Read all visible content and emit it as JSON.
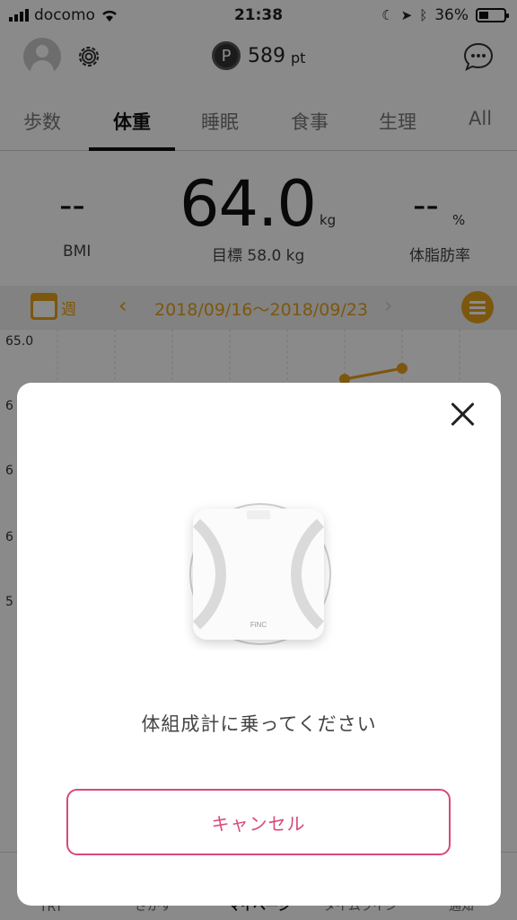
{
  "status_bar": {
    "carrier": "docomo",
    "time": "21:38",
    "battery": "36%"
  },
  "header": {
    "points_icon": "P",
    "points_value": "589",
    "points_unit": "pt"
  },
  "tabs": [
    {
      "label": "歩数"
    },
    {
      "label": "体重"
    },
    {
      "label": "睡眠"
    },
    {
      "label": "食事"
    },
    {
      "label": "生理"
    },
    {
      "label": "All"
    }
  ],
  "stats": {
    "bmi_value": "--",
    "bmi_label": "BMI",
    "weight_value": "64.0",
    "weight_unit": "kg",
    "target_label": "目標 58.0 kg",
    "fat_value": "--",
    "fat_unit": "%",
    "fat_label": "体脂肪率"
  },
  "week_bar": {
    "mode": "週",
    "range": "2018/09/16〜2018/09/23"
  },
  "chart": {
    "tick_top": "65.0",
    "tick_partial": [
      "6",
      "6",
      "6",
      "5"
    ],
    "accent": "#e6a21a"
  },
  "bottom_nav": [
    {
      "label": "TRY"
    },
    {
      "label": "さがす"
    },
    {
      "label": "マイページ"
    },
    {
      "label": "タイムライン"
    },
    {
      "label": "通知"
    }
  ],
  "modal": {
    "prompt": "体組成計に乗ってください",
    "cancel_label": "キャンセル",
    "scale_brand": "FiNC",
    "accent": "#d8487c"
  },
  "icons": {
    "close": "close-icon",
    "gear": "gear-icon",
    "chat": "chat-bubble-icon",
    "avatar": "user-avatar-icon",
    "calendar": "calendar-icon",
    "menu": "menu-icon"
  }
}
